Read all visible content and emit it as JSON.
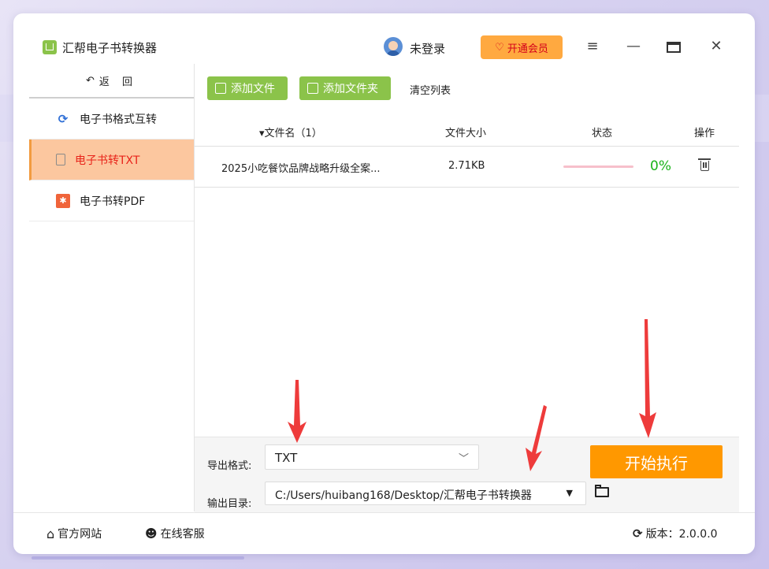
{
  "app": {
    "title": "汇帮电子书转换器"
  },
  "header": {
    "login_text": "未登录",
    "vip_label": "开通会员"
  },
  "icons": {
    "menu": "menu-icon",
    "minimize": "minimize-icon",
    "maximize": "maximize-icon",
    "close": "close-icon",
    "back": "back-arrow-icon",
    "refresh": "refresh-icon",
    "document": "document-icon",
    "pdf": "pdf-icon",
    "add_file": "add-file-icon",
    "add_folder": "add-folder-icon",
    "trash": "trash-icon",
    "folder": "folder-open-icon",
    "home": "home-icon",
    "service": "headset-icon",
    "version": "refresh-icon"
  },
  "sidebar": {
    "back_label": "返 回",
    "items": [
      {
        "label": "电子书格式互转",
        "active": false
      },
      {
        "label": "电子书转TXT",
        "active": true
      },
      {
        "label": "电子书转PDF",
        "active": false
      }
    ]
  },
  "toolbar": {
    "add_file": "添加文件",
    "add_folder": "添加文件夹",
    "clear_list": "清空列表"
  },
  "table": {
    "headers": {
      "name": "▾文件名（1）",
      "size": "文件大小",
      "status": "状态",
      "action": "操作"
    },
    "rows": [
      {
        "name": "2025小吃餐饮品牌战略升级全案...",
        "size": "2.71KB",
        "progress": 0,
        "status_text": "0%"
      }
    ]
  },
  "settings": {
    "format_label": "导出格式:",
    "format_value": "TXT",
    "dir_label": "输出目录:",
    "dir_value": "C:/Users/huibang168/Desktop/汇帮电子书转换器",
    "start_label": "开始执行"
  },
  "footer": {
    "site": "官方网站",
    "service": "在线客服",
    "version": "版本：2.0.0.0"
  },
  "colors": {
    "accent_green": "#8bc34a",
    "accent_orange": "#ff9800",
    "active_bg": "#fcc79f",
    "active_text": "#e8231a",
    "arrow_red": "#ee3b3b"
  }
}
